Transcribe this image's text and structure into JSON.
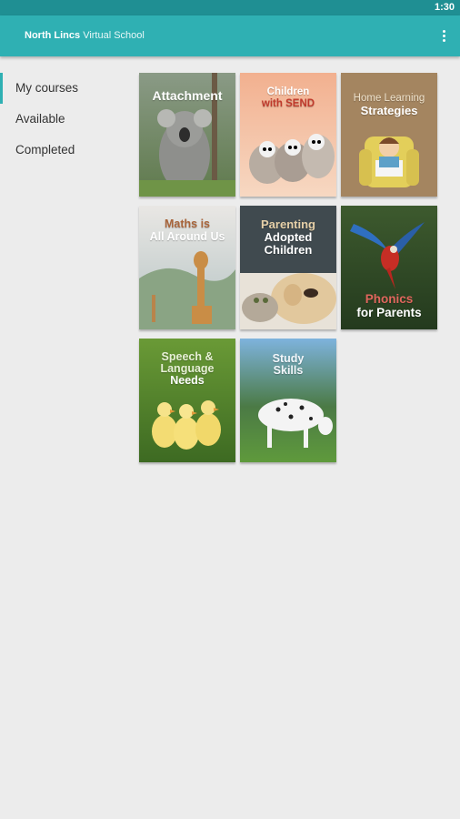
{
  "status": {
    "time": "1:30"
  },
  "appbar": {
    "title_bold": "North Lincs",
    "title_light": "Virtual School",
    "menu_icon": "more-vertical-icon"
  },
  "nav": {
    "items": [
      "My courses",
      "Available",
      "Completed"
    ],
    "active_index": 0
  },
  "courses": [
    {
      "l1": "Attachment",
      "l2": ""
    },
    {
      "l1": "Children",
      "l2": "with SEND"
    },
    {
      "l1": "Home Learning",
      "l2": "Strategies"
    },
    {
      "l1": "Maths is",
      "l2": "All Around Us"
    },
    {
      "l1": "Parenting",
      "l2": "Adopted",
      "l3": "Children"
    },
    {
      "l1": "Phonics",
      "l2": "for Parents"
    },
    {
      "l1": "Speech &",
      "l2": "Language",
      "l3": "Needs"
    },
    {
      "l1": "Study",
      "l2": "Skills"
    }
  ],
  "colors": {
    "accent": "#2fb0b3",
    "status_bar": "#1f8f93",
    "background": "#ececec"
  }
}
